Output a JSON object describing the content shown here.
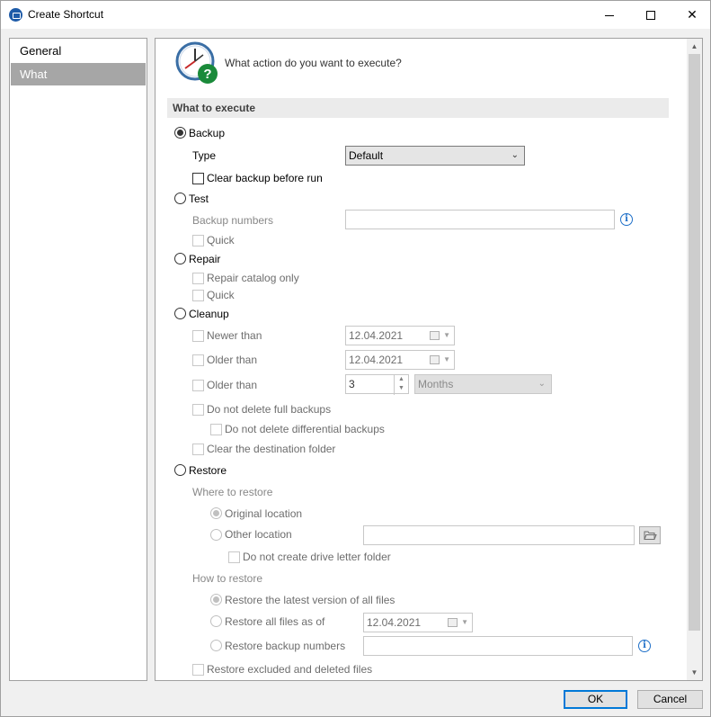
{
  "window": {
    "title": "Create Shortcut"
  },
  "nav": {
    "items": [
      {
        "label": "General"
      },
      {
        "label": "What"
      }
    ]
  },
  "header": {
    "question": "What action do you want to execute?"
  },
  "section": {
    "title": "What to execute"
  },
  "backup": {
    "label": "Backup",
    "selected": true,
    "type_label": "Type",
    "type_value": "Default",
    "clear_label": "Clear backup before run"
  },
  "test": {
    "label": "Test",
    "numbers_label": "Backup numbers",
    "numbers_value": "",
    "quick_label": "Quick"
  },
  "repair": {
    "label": "Repair",
    "catalog_only_label": "Repair catalog only",
    "quick_label": "Quick"
  },
  "cleanup": {
    "label": "Cleanup",
    "newer_label": "Newer than",
    "newer_date": "12.04.2021",
    "older_label": "Older than",
    "older_date": "12.04.2021",
    "older2_label": "Older than",
    "older2_count": "3",
    "older2_unit": "Months",
    "no_delete_full_label": "Do not delete full backups",
    "no_delete_diff_label": "Do not delete differential backups",
    "clear_dest_label": "Clear the destination folder"
  },
  "restore": {
    "label": "Restore",
    "where_label": "Where to restore",
    "original_label": "Original location",
    "other_label": "Other location",
    "other_value": "",
    "no_drive_letter_label": "Do not create drive letter folder",
    "how_label": "How to restore",
    "latest_label": "Restore the latest version of all files",
    "asof_label": "Restore all files as of",
    "asof_date": "12.04.2021",
    "numbers_label": "Restore backup numbers",
    "numbers_value": "",
    "excluded_label": "Restore excluded and deleted files"
  },
  "footer": {
    "ok_label": "OK",
    "cancel_label": "Cancel"
  },
  "colors": {
    "accent": "#0078d7",
    "nav_active": "#a6a6a6",
    "info": "#1e6fc8",
    "help_badge": "#1a8a3a"
  }
}
